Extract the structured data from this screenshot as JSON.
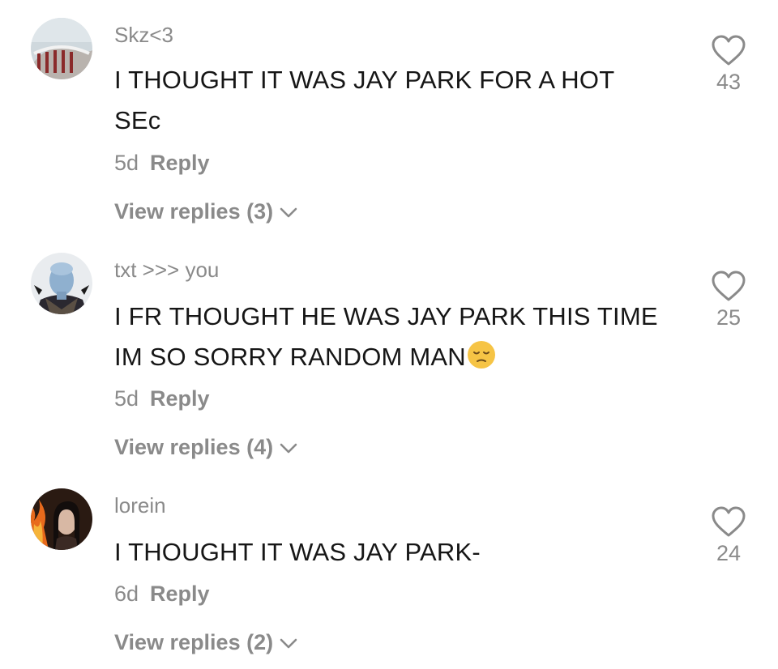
{
  "comments": [
    {
      "username": "Skz<3",
      "text_lines": [
        "I THOUGHT IT WAS JAY PARK FOR A HOT",
        "SEc"
      ],
      "age": "5d",
      "reply_label": "Reply",
      "view_replies": "View replies (3)",
      "likes": "43"
    },
    {
      "username": "txt >>> you",
      "text_lines": [
        "I FR THOUGHT HE WAS JAY PARK THIS TIME",
        "IM SO SORRY RANDOM MAN"
      ],
      "emoji": "pensive-face-emoji",
      "age": "5d",
      "reply_label": "Reply",
      "view_replies": "View replies (4)",
      "likes": "25"
    },
    {
      "username": "lorein",
      "text_lines": [
        "I THOUGHT IT WAS JAY PARK-"
      ],
      "age": "6d",
      "reply_label": "Reply",
      "view_replies": "View replies (2)",
      "likes": "24"
    }
  ],
  "icons": {
    "like": "heart-outline-icon",
    "expand": "chevron-down-icon"
  },
  "colors": {
    "text": "#161616",
    "secondary": "#8a8a8a",
    "background": "#ffffff"
  }
}
